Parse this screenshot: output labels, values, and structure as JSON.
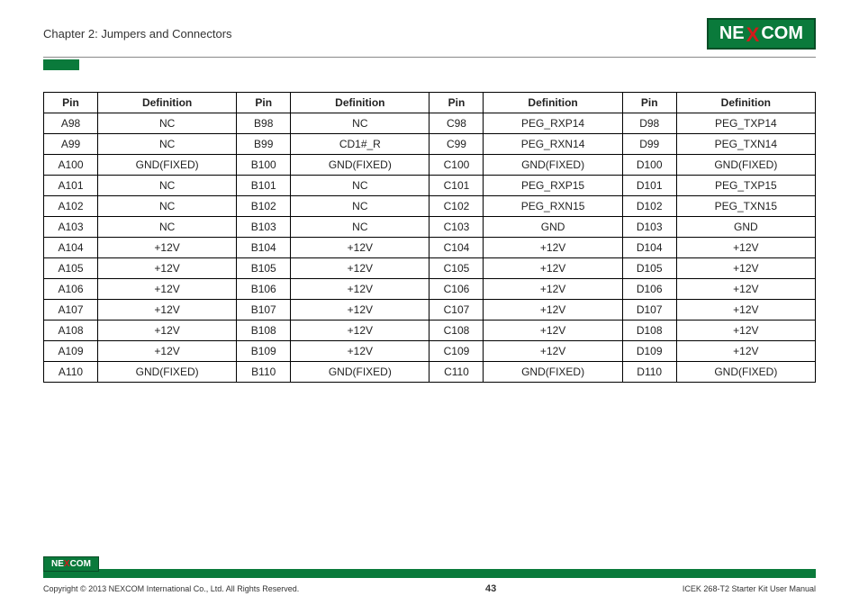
{
  "header": {
    "chapter": "Chapter 2: Jumpers and Connectors",
    "brand_pre": "NE",
    "brand_mid": "X",
    "brand_post": "COM"
  },
  "table": {
    "headers": [
      "Pin",
      "Definition",
      "Pin",
      "Definition",
      "Pin",
      "Definition",
      "Pin",
      "Definition"
    ],
    "rows": [
      [
        "A98",
        "NC",
        "B98",
        "NC",
        "C98",
        "PEG_RXP14",
        "D98",
        "PEG_TXP14"
      ],
      [
        "A99",
        "NC",
        "B99",
        "CD1#_R",
        "C99",
        "PEG_RXN14",
        "D99",
        "PEG_TXN14"
      ],
      [
        "A100",
        "GND(FIXED)",
        "B100",
        "GND(FIXED)",
        "C100",
        "GND(FIXED)",
        "D100",
        "GND(FIXED)"
      ],
      [
        "A101",
        "NC",
        "B101",
        "NC",
        "C101",
        "PEG_RXP15",
        "D101",
        "PEG_TXP15"
      ],
      [
        "A102",
        "NC",
        "B102",
        "NC",
        "C102",
        "PEG_RXN15",
        "D102",
        "PEG_TXN15"
      ],
      [
        "A103",
        "NC",
        "B103",
        "NC",
        "C103",
        "GND",
        "D103",
        "GND"
      ],
      [
        "A104",
        "+12V",
        "B104",
        "+12V",
        "C104",
        "+12V",
        "D104",
        "+12V"
      ],
      [
        "A105",
        "+12V",
        "B105",
        "+12V",
        "C105",
        "+12V",
        "D105",
        "+12V"
      ],
      [
        "A106",
        "+12V",
        "B106",
        "+12V",
        "C106",
        "+12V",
        "D106",
        "+12V"
      ],
      [
        "A107",
        "+12V",
        "B107",
        "+12V",
        "C107",
        "+12V",
        "D107",
        "+12V"
      ],
      [
        "A108",
        "+12V",
        "B108",
        "+12V",
        "C108",
        "+12V",
        "D108",
        "+12V"
      ],
      [
        "A109",
        "+12V",
        "B109",
        "+12V",
        "C109",
        "+12V",
        "D109",
        "+12V"
      ],
      [
        "A110",
        "GND(FIXED)",
        "B110",
        "GND(FIXED)",
        "C110",
        "GND(FIXED)",
        "D110",
        "GND(FIXED)"
      ]
    ]
  },
  "footer": {
    "brand_pre": "NE",
    "brand_mid": "X",
    "brand_post": "COM",
    "copyright": "Copyright © 2013 NEXCOM International Co., Ltd. All Rights Reserved.",
    "page": "43",
    "doc": "ICEK 268-T2 Starter Kit User Manual"
  }
}
